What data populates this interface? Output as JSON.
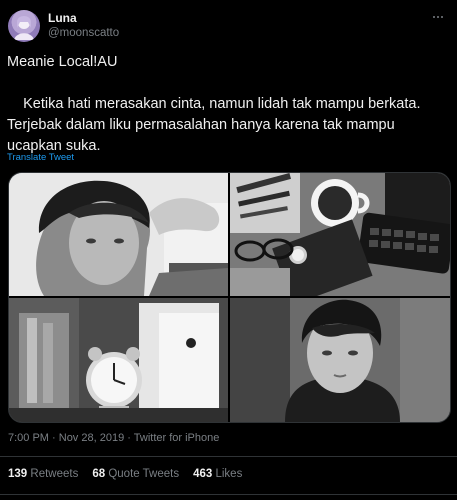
{
  "user": {
    "display_name": "Luna",
    "handle": "@moonscatto",
    "avatar_icon": "avatar-image"
  },
  "tweet": {
    "title": "Meanie Local!AU",
    "body": "    Ketika hati merasakan cinta, namun lidah tak mampu berkata. Terjebak dalam liku permasalahan hanya karena tak mampu ucapkan suka.",
    "translate_label": "Translate Tweet",
    "media": [
      {
        "name": "photo-man-hand-on-head"
      },
      {
        "name": "photo-desk-coffee-keyboard"
      },
      {
        "name": "photo-alarm-clock"
      },
      {
        "name": "photo-man-portrait"
      }
    ]
  },
  "meta": {
    "time": "7:00 PM",
    "date": "Nov 28, 2019",
    "source": "Twitter for iPhone"
  },
  "stats": {
    "retweets_count": "139",
    "retweets_label": "Retweets",
    "quotes_count": "68",
    "quotes_label": "Quote Tweets",
    "likes_count": "463",
    "likes_label": "Likes"
  },
  "colors": {
    "background": "#000000",
    "text": "#f0f0f0",
    "secondary": "#7a7f84",
    "link": "#1d9bf0",
    "border": "#2f3336"
  }
}
